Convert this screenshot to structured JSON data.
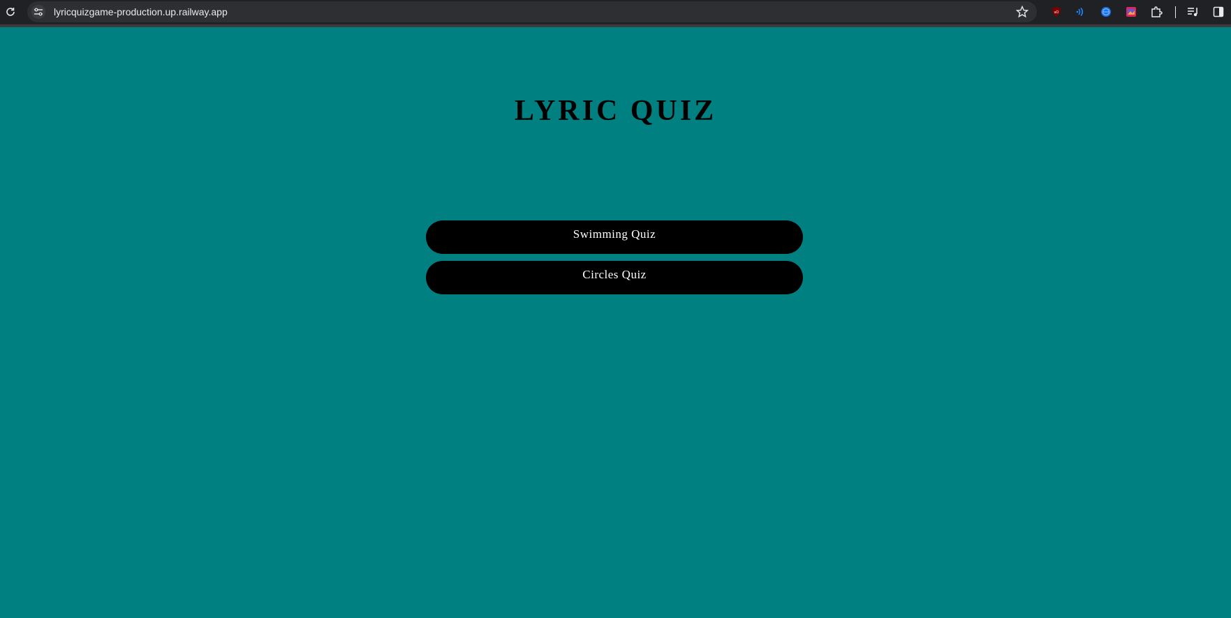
{
  "browser": {
    "url": "lyricquizgame-production.up.railway.app",
    "icons": [
      "reload-icon",
      "site-info-icon",
      "bookmark-star-icon",
      "ublock-extension-icon",
      "read-aloud-extension-icon",
      "globe-extension-icon",
      "colorful-extension-icon",
      "extensions-puzzle-icon",
      "media-controls-icon",
      "side-panel-icon"
    ],
    "colors": {
      "chrome_bg": "#202124",
      "omnibox_bg": "#2e2f32",
      "text": "#e8eaed"
    }
  },
  "page": {
    "title": "LYRIC QUIZ",
    "background": "#008080",
    "quizzes": [
      {
        "label": "Swimming Quiz"
      },
      {
        "label": "Circles Quiz"
      }
    ]
  }
}
